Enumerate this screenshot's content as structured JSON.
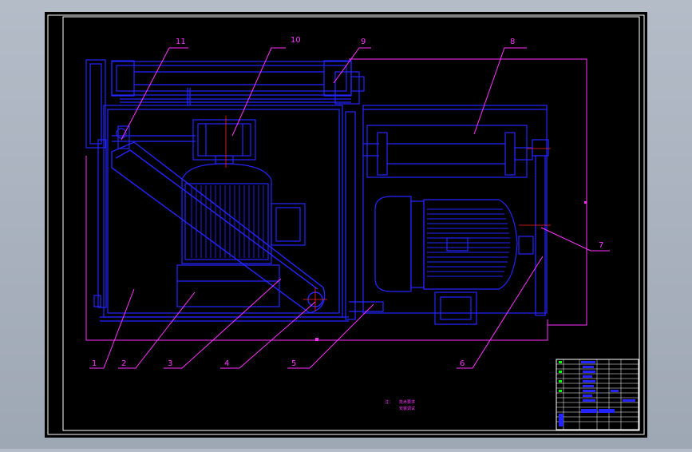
{
  "drawing": {
    "part_labels": [
      "1",
      "2",
      "3",
      "4",
      "5",
      "6",
      "7",
      "8",
      "9",
      "10",
      "11"
    ],
    "notes": [
      "注：",
      "技术要求",
      "安装调试"
    ],
    "colors": {
      "background_outer": "#a9b1bd",
      "paper": "#000000",
      "frame_white": "#ffffff",
      "drawing_blue": "#2424ff",
      "leader_magenta": "#ff30ff",
      "table_green": "#00ff00",
      "table_white": "#ffffff",
      "red_line": "#ff2020"
    }
  }
}
